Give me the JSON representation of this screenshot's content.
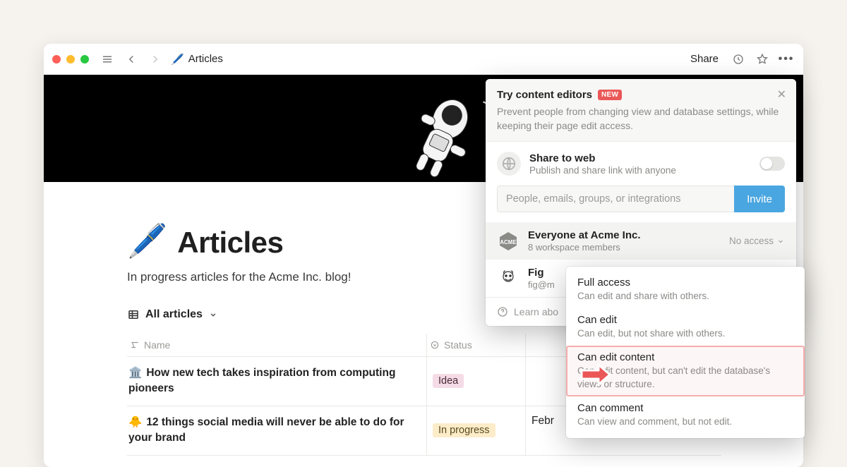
{
  "breadcrumb": {
    "title": "Articles"
  },
  "topbar": {
    "share": "Share"
  },
  "page": {
    "title": "Articles",
    "description": "In progress articles for the Acme Inc. blog!",
    "view_label": "All articles"
  },
  "table": {
    "columns": {
      "name": "Name",
      "status": "Status"
    },
    "rows": [
      {
        "emoji": "🏛️",
        "title": "How new tech takes inspiration from computing pioneers",
        "status": "Idea",
        "status_style": "pink",
        "date": ""
      },
      {
        "emoji": "🐥",
        "title": "12 things social media will never be able to do for your brand",
        "status": "In progress",
        "status_style": "yellow",
        "date": "Febr"
      }
    ]
  },
  "popover": {
    "title": "Try content editors",
    "badge": "NEW",
    "subtitle": "Prevent people from changing view and database settings, while keeping their page edit access.",
    "share_web": {
      "title": "Share to web",
      "subtitle": "Publish and share link with anyone"
    },
    "invite": {
      "placeholder": "People, emails, groups, or integrations",
      "button": "Invite"
    },
    "members": [
      {
        "name": "Everyone at Acme Inc.",
        "sub": "8 workspace members",
        "access": "No access"
      },
      {
        "name": "Fig",
        "sub": "fig@m"
      }
    ],
    "learn": "Learn abo"
  },
  "perm_menu": [
    {
      "title": "Full access",
      "sub": "Can edit and share with others."
    },
    {
      "title": "Can edit",
      "sub": "Can edit, but not share with others."
    },
    {
      "title": "Can edit content",
      "sub": "Can edit content, but can't edit the database's views or structure.",
      "highlight": true
    },
    {
      "title": "Can comment",
      "sub": "Can view and comment, but not edit."
    }
  ]
}
